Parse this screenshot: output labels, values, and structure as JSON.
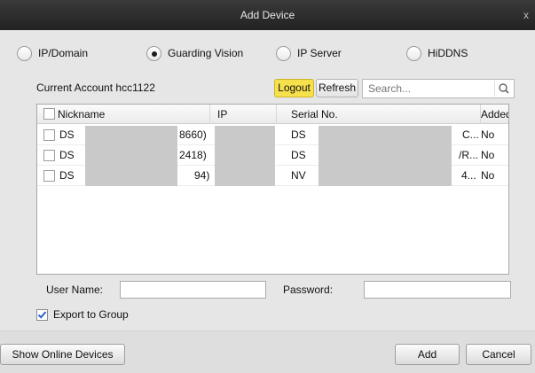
{
  "window": {
    "title": "Add Device",
    "close_glyph": "x"
  },
  "modes": [
    {
      "label": "IP/Domain",
      "checked": false
    },
    {
      "label": "Guarding Vision",
      "checked": true
    },
    {
      "label": "IP Server",
      "checked": false
    },
    {
      "label": "HiDDNS",
      "checked": false
    }
  ],
  "account": {
    "label": "Current Account",
    "name": "hcc1122",
    "logout_label": "Logout",
    "refresh_label": "Refresh",
    "search_placeholder": "Search..."
  },
  "table": {
    "columns": [
      "Nickname",
      "IP",
      "Serial No.",
      "Added"
    ],
    "rows": [
      {
        "nickname_prefix": "DS",
        "nickname_suffix": "8660)",
        "serial_prefix": "DS",
        "serial_suffix": "C...",
        "added": "No"
      },
      {
        "nickname_prefix": "DS",
        "nickname_suffix": "2418)",
        "serial_prefix": "DS",
        "serial_suffix": "/R...",
        "added": "No"
      },
      {
        "nickname_prefix": "DS",
        "nickname_suffix": "94)",
        "serial_prefix": "NV",
        "serial_suffix": "4...",
        "added": "No"
      }
    ]
  },
  "form": {
    "username_label": "User Name:",
    "username_value": "",
    "password_label": "Password:",
    "password_value": "",
    "export_label": "Export to Group",
    "export_checked": true
  },
  "footer": {
    "show_online_label": "Show Online Devices",
    "add_label": "Add",
    "cancel_label": "Cancel"
  },
  "colors": {
    "logout_bg": "#f6e04b",
    "title_bg": "#2b2b2b",
    "check_blue": "#2a62c9"
  },
  "icons": {
    "search": "magnifier-icon",
    "close": "close-icon",
    "check": "checkmark-icon"
  }
}
